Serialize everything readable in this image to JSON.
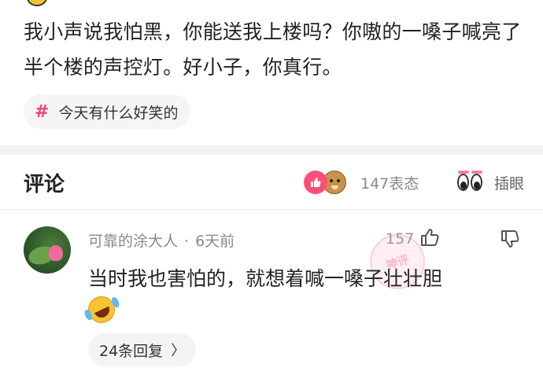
{
  "post": {
    "text": "我小声说我怕黑，你能送我上楼吗？你嗷的一嗓子喊亮了半个楼的声控灯。好小子，你真行。",
    "topic_hash": "#",
    "topic": "今天有什么好笑的"
  },
  "comments_section": {
    "title": "评论",
    "reaction_count": "147表态",
    "eyes_label": "插眼"
  },
  "comment": {
    "author": "可靠的涂大人",
    "separator": "·",
    "time": "6天前",
    "likes": "157",
    "text": "当时我也害怕的，就想着喊一嗓子壮壮胆",
    "replies": "24条回复",
    "replies_chevron": "〉"
  },
  "watermark": {
    "text": "神评"
  },
  "colors": {
    "accent_pink": "#ff4f7a",
    "topic_hash": "#f0457a",
    "muted_text": "#8a8a8a"
  },
  "icons": [
    "thumbs-up-icon",
    "doge-reaction-icon",
    "eyes-icon",
    "dislike-icon",
    "laughing-crying-emoji"
  ]
}
